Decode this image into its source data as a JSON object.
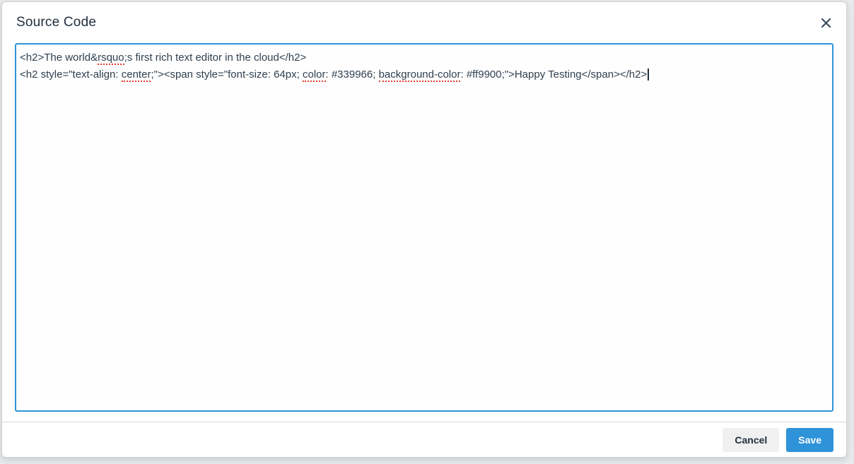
{
  "dialog": {
    "title": "Source Code"
  },
  "icons": {
    "close": "close-icon"
  },
  "editor": {
    "lines": [
      {
        "segments": [
          {
            "text": "<h2>The world&"
          },
          {
            "text": "rsquo",
            "misspelled": true
          },
          {
            "text": ";s first rich text editor in the cloud</h2>"
          }
        ]
      },
      {
        "segments": [
          {
            "text": "<h2 style=\"text-align: "
          },
          {
            "text": "center",
            "misspelled": true
          },
          {
            "text": ";\"><span style=\"font-size: 64px; "
          },
          {
            "text": "color",
            "misspelled": true
          },
          {
            "text": ": #339966; "
          },
          {
            "text": "background-color",
            "misspelled": true
          },
          {
            "text": ": #ff9900;\">Happy Testing</span></h2>"
          }
        ],
        "caret": true
      }
    ]
  },
  "footer": {
    "cancel_label": "Cancel",
    "save_label": "Save"
  },
  "colors": {
    "primary_blue": "#2e93d9",
    "title_text": "#222f3e",
    "code_text": "#30404f",
    "misspell_underline": "#e23b2e",
    "cancel_bg": "#f0f0f0",
    "footer_divider": "#d4d7da",
    "page_background": "#e7e9eb",
    "inline_color_value_1": "#339966",
    "inline_color_value_2": "#ff9900"
  }
}
